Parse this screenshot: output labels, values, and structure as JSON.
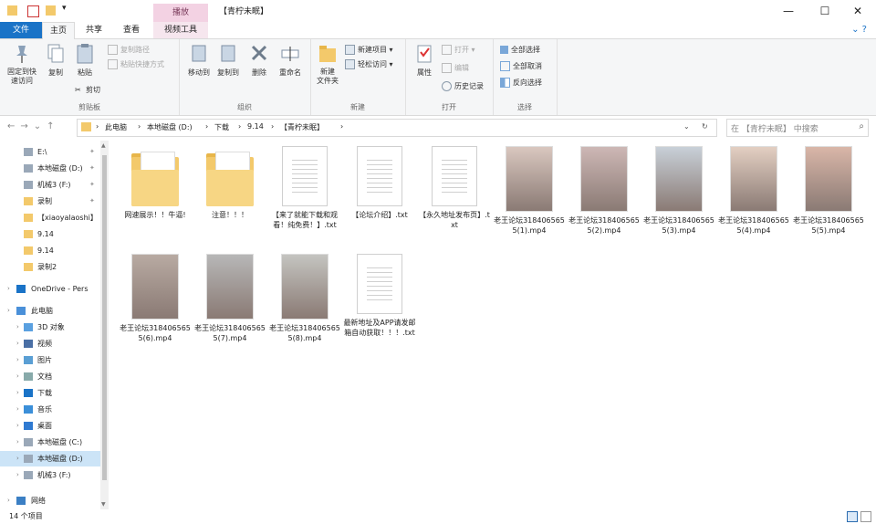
{
  "window": {
    "title": "【青柠未眠】",
    "context_tab": "播放",
    "controls": {
      "minimize": "—",
      "maximize": "☐",
      "close": "✕"
    }
  },
  "tabs": {
    "file": "文件",
    "home": "主页",
    "share": "共享",
    "view": "查看",
    "video": "视频工具"
  },
  "ribbon": {
    "pin": "固定到快\n速访问",
    "copy": "复制",
    "paste": "粘贴",
    "copy_path": "复制路径",
    "paste_shortcut": "粘贴快捷方式",
    "cut": "剪切",
    "clipboard_group": "剪贴板",
    "move_to": "移动到",
    "copy_to": "复制到",
    "delete": "删除",
    "rename": "重命名",
    "organize_group": "组织",
    "new_item": "新建项目 ▾",
    "easy_access": "轻松访问 ▾",
    "new_folder": "新建\n文件夹",
    "new_group": "新建",
    "properties": "属性",
    "open": "打开 ▾",
    "edit": "编辑",
    "history": "历史记录",
    "open_group": "打开",
    "select_all": "全部选择",
    "select_none": "全部取消",
    "invert": "反向选择",
    "select_group": "选择"
  },
  "address": {
    "crumbs": [
      "此电脑",
      "本地磁盘 (D:)",
      "下载",
      "9.14",
      "【青柠未眠】"
    ],
    "search_placeholder": "在 【青柠未眠】 中搜索"
  },
  "nav": [
    {
      "label": "E:\\",
      "icon": "drive"
    },
    {
      "label": "本地磁盘 (D:)",
      "icon": "drive"
    },
    {
      "label": "机械3 (F:)",
      "icon": "drive"
    },
    {
      "label": "录制",
      "icon": "folder"
    },
    {
      "label": "【xiaoyalaoshi】",
      "icon": "folder"
    },
    {
      "label": "9.14",
      "icon": "folder"
    },
    {
      "label": "9.14",
      "icon": "folder"
    },
    {
      "label": "录制2",
      "icon": "folder"
    },
    {
      "label": "OneDrive - Pers",
      "icon": "cloud"
    },
    {
      "label": "此电脑",
      "icon": "pc"
    },
    {
      "label": "3D 对象",
      "icon": "3d"
    },
    {
      "label": "视频",
      "icon": "video"
    },
    {
      "label": "图片",
      "icon": "picture"
    },
    {
      "label": "文档",
      "icon": "document"
    },
    {
      "label": "下载",
      "icon": "download"
    },
    {
      "label": "音乐",
      "icon": "music"
    },
    {
      "label": "桌面",
      "icon": "desktop"
    },
    {
      "label": "本地磁盘 (C:)",
      "icon": "drive"
    },
    {
      "label": "本地磁盘 (D:)",
      "icon": "drive"
    },
    {
      "label": "机械3 (F:)",
      "icon": "drive"
    },
    {
      "label": "网络",
      "icon": "network"
    }
  ],
  "files": [
    {
      "name": "网速展示！！牛逼!",
      "type": "folder"
    },
    {
      "name": "注意！！！",
      "type": "folder"
    },
    {
      "name": "【来了就能下载和观看！纯免费！】.txt",
      "type": "txt"
    },
    {
      "name": "【论坛介绍】.txt",
      "type": "txt"
    },
    {
      "name": "【永久地址发布页】.txt",
      "type": "txt"
    },
    {
      "name": "老王论坛3184065655(1).mp4",
      "type": "video"
    },
    {
      "name": "老王论坛3184065655(2).mp4",
      "type": "video"
    },
    {
      "name": "老王论坛3184065655(3).mp4",
      "type": "video"
    },
    {
      "name": "老王论坛3184065655(4).mp4",
      "type": "video"
    },
    {
      "name": "老王论坛3184065655(5).mp4",
      "type": "video"
    },
    {
      "name": "老王论坛3184065655(6).mp4",
      "type": "video"
    },
    {
      "name": "老王论坛3184065655(7).mp4",
      "type": "video"
    },
    {
      "name": "老王论坛3184065655(8).mp4",
      "type": "video"
    },
    {
      "name": "最新地址及APP请发邮箱自动获取！！！.txt",
      "type": "txt"
    }
  ],
  "status": {
    "count": "14 个项目"
  },
  "colors": {
    "accent": "#1a73c7",
    "folder": "#f3c96b",
    "selection": "#cce4f7"
  }
}
